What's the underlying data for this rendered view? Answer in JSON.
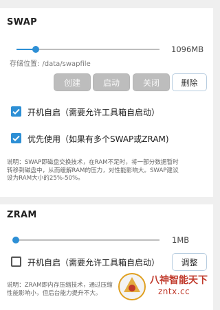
{
  "swap": {
    "title": "SWAP",
    "slider_value": "1096MB",
    "slider_fraction": 0.14,
    "path_label": "存储位置:",
    "path_value": "/data/swapfile",
    "buttons": {
      "create": "创建",
      "start": "启动",
      "stop": "关闭",
      "delete": "删除"
    },
    "autostart_label": "开机自启（需要允许工具箱自启动）",
    "autostart_checked": true,
    "priority_label": "优先使用（如果有多个SWAP或ZRAM)",
    "priority_checked": true,
    "note_lines": [
      "说明：SWAP即磁盘交换技术，在RAM不足时，将一部分数据暂时",
      "转移到磁盘中，从而缓解RAM的压力，对性能影响大。SWAP建议",
      "设为RAM大小的25%-50%。"
    ]
  },
  "zram": {
    "title": "ZRAM",
    "slider_value": "1MB",
    "slider_fraction": 0.0,
    "autostart_label": "开机自启（需要允许工具箱自启动）",
    "autostart_checked": false,
    "adjust_button": "调整",
    "note_lines": [
      "说明：ZRAM即内存压缩技术，通过压缩",
      "性能影响小，但后台能力提升不大。"
    ]
  },
  "watermark": {
    "text": "八神智能天下",
    "url": "zntx.cc"
  },
  "colors": {
    "accent": "#2d8fd5",
    "disabled": "#bdbdbd",
    "watermark": "#c0392b"
  }
}
